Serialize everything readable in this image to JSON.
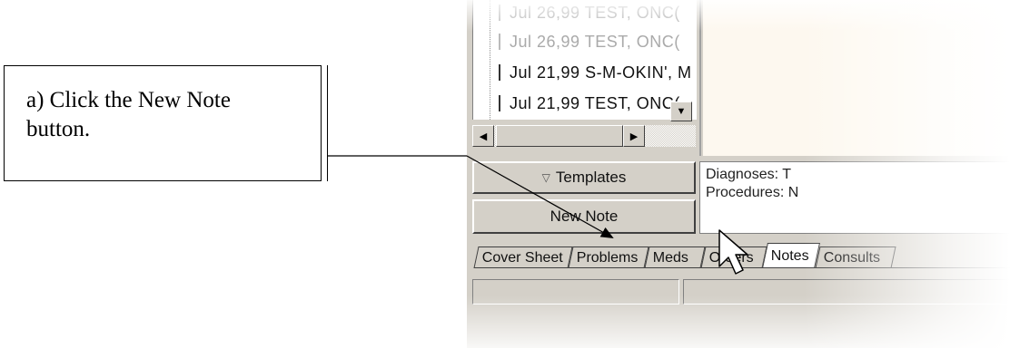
{
  "callout": {
    "text": "a) Click the New Note button."
  },
  "notes_tree": {
    "items": [
      {
        "date": "Jul 26,99",
        "name": "TEST, ONC("
      },
      {
        "date": "Jul 26,99",
        "name": "TEST, ONC("
      },
      {
        "date": "Jul 21,99",
        "name": "S-M-OKIN', M"
      },
      {
        "date": "Jul 21,99",
        "name": "TEST, ONC("
      }
    ]
  },
  "buttons": {
    "templates": "Templates",
    "new_note": "New Note"
  },
  "info": {
    "diagnoses": "Diagnoses: T",
    "procedures": "Procedures: N"
  },
  "tabs": [
    "Cover Sheet",
    "Problems",
    "Meds",
    "Orders",
    "Notes",
    "Consults"
  ],
  "active_tab": "Notes",
  "icons": [
    "document-icon",
    "scroll-down-arrow-icon",
    "scroll-left-arrow-icon",
    "scroll-right-arrow-icon",
    "mouse-pointer-icon",
    "templates-triangle-icon"
  ]
}
